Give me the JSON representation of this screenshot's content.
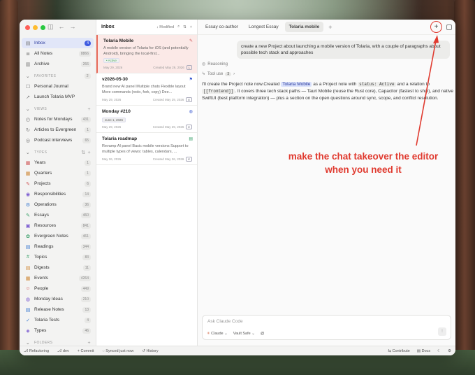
{
  "sidebar": {
    "top_items": [
      {
        "icon": "inbox-icon",
        "glyph": "▤",
        "label": "Inbox",
        "count": "4",
        "active": true
      },
      {
        "icon": "notes-icon",
        "glyph": "≣",
        "label": "All Notes",
        "count": "8866"
      },
      {
        "icon": "archive-icon",
        "glyph": "▥",
        "label": "Archive",
        "count": "266"
      }
    ],
    "favorites_heading": "FAVORITES",
    "favorites_count": "2",
    "favorites": [
      {
        "icon": "journal-icon",
        "glyph": "☐",
        "label": "Personal Journal"
      },
      {
        "icon": "rocket-icon",
        "glyph": "↗",
        "label": "Launch Tolaria MVP"
      }
    ],
    "views_heading": "VIEWS",
    "views": [
      {
        "icon": "calendar-icon",
        "glyph": "◴",
        "label": "Notes for Mondays",
        "count": "431"
      },
      {
        "icon": "evergreen-icon",
        "glyph": "↻",
        "label": "Articles to Evergreen",
        "count": "1"
      },
      {
        "icon": "podcast-icon",
        "glyph": "◎",
        "label": "Podcast interviews",
        "count": "65"
      }
    ],
    "types_heading": "TYPES",
    "types": [
      {
        "icon": "years-icon",
        "glyph": "▦",
        "color": "#d05a5a",
        "label": "Years",
        "count": "1"
      },
      {
        "icon": "quarters-icon",
        "glyph": "▦",
        "color": "#d08a3a",
        "label": "Quarters",
        "count": "1"
      },
      {
        "icon": "projects-icon",
        "glyph": "✎",
        "color": "#d05a5a",
        "label": "Projects",
        "count": "6"
      },
      {
        "icon": "responsibilities-icon",
        "glyph": "◉",
        "color": "#7a5ad0",
        "label": "Responsibilities",
        "count": "14"
      },
      {
        "icon": "operations-icon",
        "glyph": "⚙",
        "color": "#3a7ad0",
        "label": "Operations",
        "count": "36"
      },
      {
        "icon": "essays-icon",
        "glyph": "✎",
        "color": "#3aa06a",
        "label": "Essays",
        "count": "460"
      },
      {
        "icon": "resources-icon",
        "glyph": "▣",
        "color": "#7a5ad0",
        "label": "Resources",
        "count": "841"
      },
      {
        "icon": "evergreen-notes-icon",
        "glyph": "✿",
        "color": "#3aa06a",
        "label": "Evergreen Notes",
        "count": "461"
      },
      {
        "icon": "readings-icon",
        "glyph": "▤",
        "color": "#3a7ad0",
        "label": "Readings",
        "count": "344"
      },
      {
        "icon": "topics-icon",
        "glyph": "#",
        "color": "#3aa06a",
        "label": "Topics",
        "count": "83"
      },
      {
        "icon": "digests-icon",
        "glyph": "▤",
        "color": "#d08a3a",
        "label": "Digests",
        "count": "11"
      },
      {
        "icon": "events-icon",
        "glyph": "▦",
        "color": "#d08a3a",
        "label": "Events",
        "count": "4264"
      },
      {
        "icon": "people-icon",
        "glyph": "☺",
        "color": "#d05a5a",
        "label": "People",
        "count": "449"
      },
      {
        "icon": "monday-ideas-icon",
        "glyph": "◍",
        "color": "#7a5ad0",
        "label": "Monday Ideas",
        "count": "210"
      },
      {
        "icon": "release-notes-icon",
        "glyph": "▤",
        "color": "#3a7ad0",
        "label": "Release Notes",
        "count": "13"
      },
      {
        "icon": "tests-icon",
        "glyph": "✓",
        "color": "#3a7ad0",
        "label": "Tolaria Tests",
        "count": "4"
      },
      {
        "icon": "types-icon",
        "glyph": "◈",
        "color": "#7a5ad0",
        "label": "Types",
        "count": "46"
      }
    ],
    "folders_heading": "FOLDERS"
  },
  "notelist": {
    "title": "Inbox",
    "sort_label": "↓ Modified",
    "notes": [
      {
        "title": "Tolaria Mobile",
        "snippet": "A mobile version of Tolaria for iOS (and potentially Android), bringing the local-first...",
        "tag": "• Active",
        "date": "May 29, 2026",
        "created": "Created May 29, 2026",
        "badge": "L",
        "type_glyph": "✎",
        "type_color": "#d05a5a",
        "type_icon": "project-icon",
        "selected": true
      },
      {
        "title": "v2026-05-30",
        "snippet": "Brand new AI panel Multiple chats Flexible layout More commands (redo, fork, copy) Dee...",
        "tag": "",
        "date": "May 29, 2026",
        "created": "Created May 29, 2026",
        "badge": "E",
        "type_glyph": "⚑",
        "type_color": "#3a5ad0",
        "type_icon": "flag-icon",
        "selected": false
      },
      {
        "title": "Monday #210",
        "snippet": "",
        "tag": "June 1, 2026",
        "date": "May 29, 2026",
        "created": "Created May 29, 2026",
        "badge": "E",
        "type_glyph": "◍",
        "type_color": "#3a5ad0",
        "type_icon": "lightbulb-icon",
        "selected": false
      },
      {
        "title": "Tolaria roadmap",
        "snippet": "Revamp AI panel Basic mobile versions Support to multiple types of views: tables, calendars, ...",
        "tag": "",
        "date": "May 26, 2026",
        "created": "Created May 26, 2026",
        "badge": "E",
        "type_glyph": "▤",
        "type_color": "#3aa06a",
        "type_icon": "document-icon",
        "selected": false
      }
    ]
  },
  "tabs": [
    {
      "label": "Essay co-author",
      "active": false
    },
    {
      "label": "Longest Essay",
      "active": false
    },
    {
      "label": "Tolaria mobile",
      "active": true
    }
  ],
  "chat": {
    "user_message": "create a new Project about launching a mobile version of Tolaria, with a couple of paragraphs about possible tech stack and approaches",
    "reasoning_label": "Reasoning",
    "tool_use_label": "Tool use",
    "tool_use_count": "3",
    "answer": {
      "part1": "I'll create the Project note now.Created",
      "highlight": "Tolaria Mobile",
      "part2": "as a Project note with",
      "code1": "status: Active",
      "part3": "and a relation to",
      "code2": "[[frontend]]",
      "part4": ". It covers three tech stack paths — Tauri Mobile (reuse the Rust core), Capacitor (fastest to ship), and native SwiftUI (best platform integration) — plus a section on the open questions around sync, scope, and conflict resolution."
    },
    "annotation": "make the chat takeover the editor when you need it",
    "composer_placeholder": "Ask Claude Code",
    "model_label": "Claude",
    "vault_label": "Vault Safe",
    "annotation_color": "#e03a2f"
  },
  "status": {
    "branch_label": "Refactoring",
    "env_label": "dev",
    "commit_label": "Commit",
    "sync_label": "Synced just now",
    "history_label": "History",
    "contribute_label": "Contribute",
    "docs_label": "Docs"
  }
}
